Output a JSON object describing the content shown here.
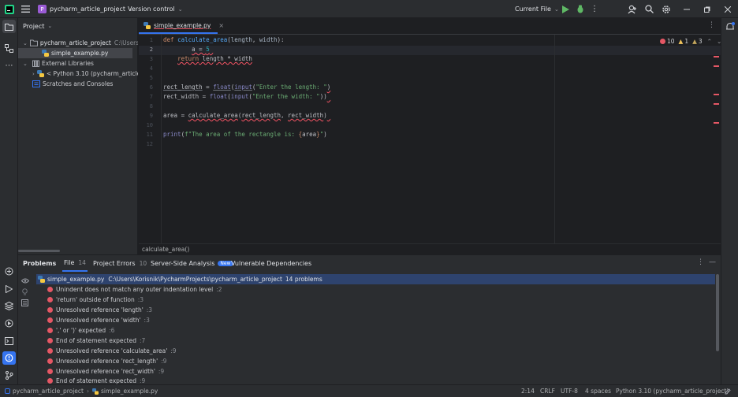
{
  "titlebar": {
    "project_badge": "P",
    "project_name": "pycharm_article_project",
    "vcs": "Version control",
    "run_config": "Current File"
  },
  "project_panel": {
    "title": "Project",
    "items": [
      {
        "label": "pycharm_article_project",
        "path": "C:\\Users\\Kori"
      },
      {
        "label": "simple_example.py"
      },
      {
        "label": "External Libraries"
      },
      {
        "label": "< Python 3.10 (pycharm_article_p"
      },
      {
        "label": "Scratches and Consoles"
      }
    ]
  },
  "editor": {
    "tab_label": "simple_example.py",
    "inspection": {
      "errors": "10",
      "warnings": "1",
      "weak_warnings": "3"
    },
    "line_numbers": [
      "1",
      "2",
      "3",
      "4",
      "5",
      "6",
      "7",
      "8",
      "9",
      "10",
      "11",
      "12"
    ],
    "breadcrumb": "calculate_area()"
  },
  "problems": {
    "tabs": [
      {
        "label": "Problems"
      },
      {
        "label": "File",
        "count": "14"
      },
      {
        "label": "Project Errors",
        "count": "10"
      },
      {
        "label": "Server-Side Analysis",
        "badge": "New"
      },
      {
        "label": "Vulnerable Dependencies"
      }
    ],
    "file_row": {
      "file": "simple_example.py",
      "path": "C:\\Users\\Korisnik\\PycharmProjects\\pycharm_article_project",
      "count": "14 problems"
    },
    "items": [
      {
        "text": "Unindent does not match any outer indentation level",
        "line": ":2"
      },
      {
        "text": "'return' outside of function",
        "line": ":3"
      },
      {
        "text": "Unresolved reference 'length'",
        "line": ":3"
      },
      {
        "text": "Unresolved reference 'width'",
        "line": ":3"
      },
      {
        "text": "',' or ')' expected",
        "line": ":6"
      },
      {
        "text": "End of statement expected",
        "line": ":7"
      },
      {
        "text": "Unresolved reference 'calculate_area'",
        "line": ":9"
      },
      {
        "text": "Unresolved reference 'rect_length'",
        "line": ":9"
      },
      {
        "text": "Unresolved reference 'rect_width'",
        "line": ":9"
      },
      {
        "text": "End of statement expected",
        "line": ":9"
      }
    ]
  },
  "statusbar": {
    "project": "pycharm_article_project",
    "file": "simple_example.py",
    "position": "2:14",
    "line_sep": "CRLF",
    "encoding": "UTF-8",
    "indent": "4 spaces",
    "interpreter": "Python 3.10 (pycharm_article_project)"
  },
  "colors": {
    "accent": "#3574f0",
    "error": "#e55765",
    "warning": "#f2c55c",
    "selection": "#2e436e"
  }
}
